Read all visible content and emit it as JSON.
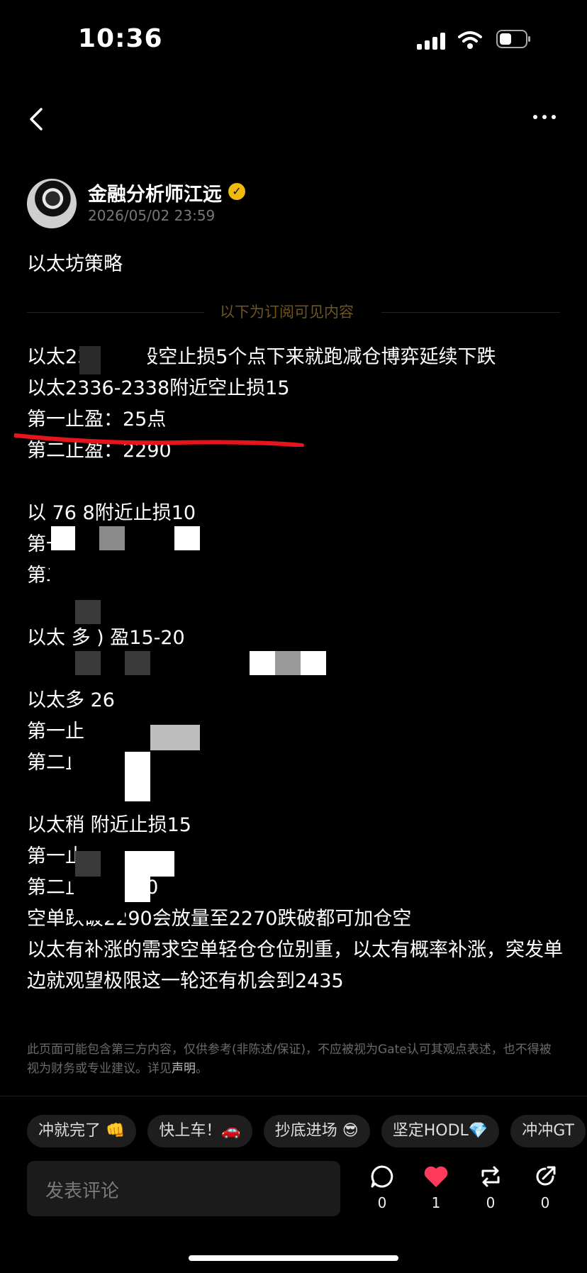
{
  "status_bar": {
    "time": "10:36"
  },
  "post": {
    "author": "金融分析师江远",
    "timestamp": "2026/05/02 23:59",
    "title": "以太坊策略",
    "subscriber_divider": "以下为订阅可见内容",
    "lines": {
      "l1": "以太23   26波段空止损5个点下来就跑减仓博弈延续下跌",
      "l2": "以太2336-2338附近空止损15",
      "l3": "第一止盈：25点",
      "l4": "第二止盈：2290",
      "l5": "以        76     8附近止损10",
      "l6": "第一",
      "l7": "第二       23",
      "l8": "以太        多           )         盈15-20",
      "l9": "以太多        26",
      "l10": "第一止",
      "l11": "第二止",
      "l12": "以太稍        附近止损15",
      "l13": "第一止",
      "l14": "第二止盈    2270",
      "l15": "空单跌破2290会放量至2270跌破都可加仓空",
      "l16": "以太有补涨的需求空单轻仓仓位别重，以太有概率补涨，突发单边就观望极限这一轮还有机会到2435"
    },
    "disclaimer": "此页面可能包含第三方内容，仅供参考(非陈述/保证)，不应被视为Gate认可其观点表述，也不得被视为财务或专业建议。详见",
    "disclaimer_link": "声明",
    "disclaimer_end": "。"
  },
  "reactions": [
    {
      "label": "冲就完了 👊"
    },
    {
      "label": "快上车！🚗"
    },
    {
      "label": "抄底进场 😎"
    },
    {
      "label": "坚定HODL💎"
    },
    {
      "label": "冲冲GT"
    }
  ],
  "comment": {
    "placeholder": "发表评论"
  },
  "actions": {
    "comment_count": "0",
    "like_count": "1",
    "repost_count": "0",
    "share_count": "0"
  },
  "colors": {
    "like": "#ff3b5c",
    "divider_text": "#6e5520",
    "verified": "#f0b90b",
    "highlight": "#e8141c"
  }
}
